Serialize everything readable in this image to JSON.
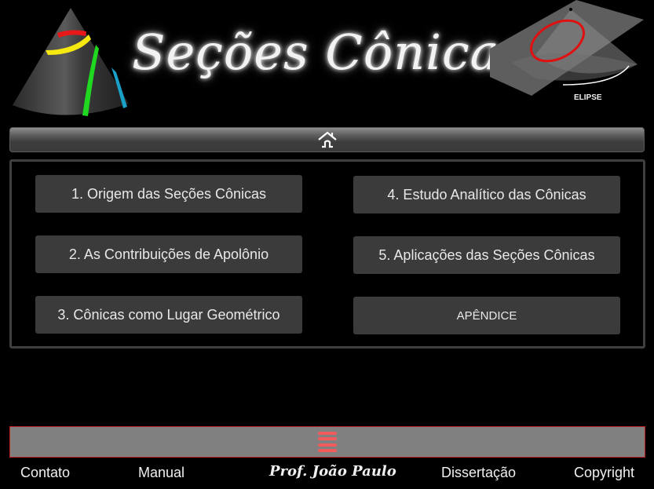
{
  "header": {
    "title": "Seções Cônicas",
    "left_image": "cone-with-conic-sections-icon",
    "right_image": "cone-plane-ellipse-figure",
    "right_image_caption": "ELIPSE",
    "section_colors": [
      "#e81818",
      "#f5e90f",
      "#1fd81f",
      "#1a9fc7"
    ]
  },
  "home_bar": {
    "icon": "home-icon"
  },
  "menu": {
    "items": [
      {
        "label": "1. Origem das Seções Cônicas"
      },
      {
        "label": "2. As Contribuições de Apolônio"
      },
      {
        "label": "3. Cônicas como Lugar Geométrico"
      },
      {
        "label": "4. Estudo Analítico das Cônicas"
      },
      {
        "label": "5. Aplicações das Seções Cônicas"
      },
      {
        "label": "APÊNDICE"
      }
    ]
  },
  "bottom_bar": {
    "icon": "hamburger-menu-icon",
    "icon_color": "#f25b5b"
  },
  "footer": {
    "contato": "Contato",
    "manual": "Manual",
    "signature": "Prof. João Paulo",
    "dissertacao": "Dissertação",
    "copyright": "Copyright"
  }
}
